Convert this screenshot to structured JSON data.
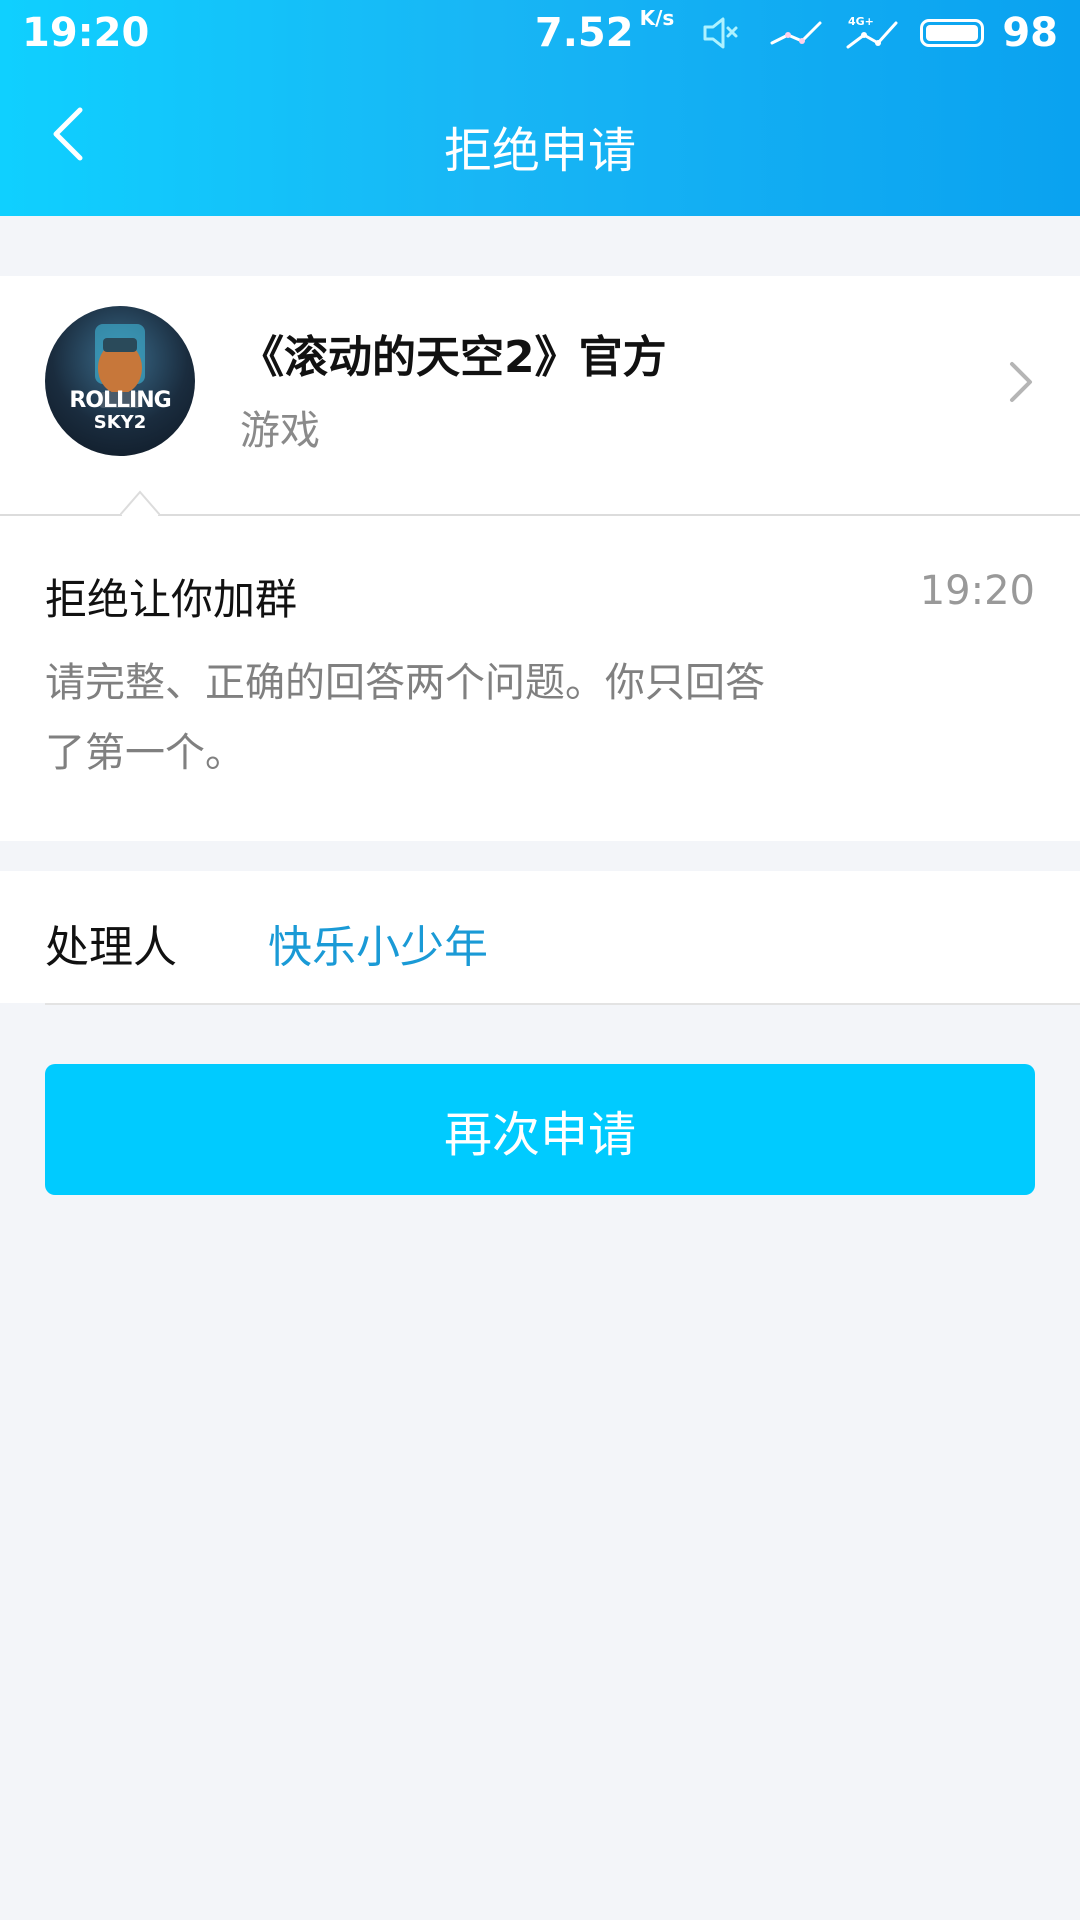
{
  "status_bar": {
    "time": "19:20",
    "speed": "7.52",
    "speed_unit": "K/s",
    "network_label": "4G+",
    "battery": "98"
  },
  "header": {
    "title": "拒绝申请",
    "back_icon": "chevron-left-icon"
  },
  "group": {
    "name": "《滚动的天空2》官方",
    "type": "游戏",
    "avatar_text_line1": "ROLLING",
    "avatar_text_line2": "SKY2"
  },
  "message": {
    "title": "拒绝让你加群",
    "time": "19:20",
    "body_line1": "请完整、正确的回答两个问题。你只回答",
    "body_line2": "了第一个。"
  },
  "handler": {
    "label": "处理人",
    "name": "快乐小少年"
  },
  "actions": {
    "reapply_label": "再次申请"
  },
  "colors": {
    "header_gradient_start": "#0fd0ff",
    "header_gradient_end": "#0aa2f0",
    "button": "#00cbff",
    "link": "#1a9ad6",
    "background": "#f3f5f9"
  }
}
